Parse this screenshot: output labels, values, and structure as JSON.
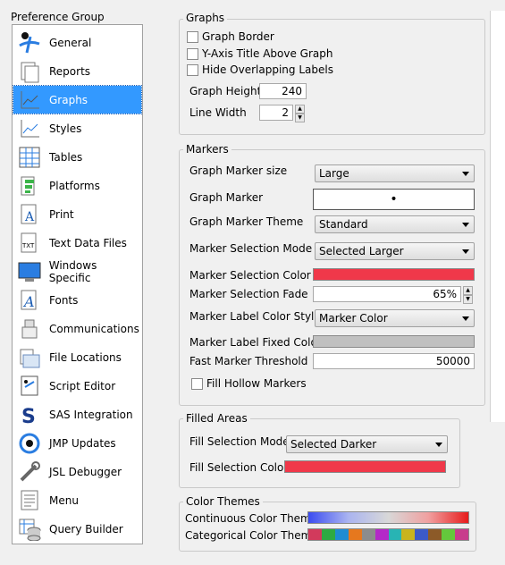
{
  "preference_group": {
    "title": "Preference Group",
    "items": [
      {
        "label": "General",
        "icon": "general-icon"
      },
      {
        "label": "Reports",
        "icon": "reports-icon"
      },
      {
        "label": "Graphs",
        "icon": "graphs-icon",
        "selected": true
      },
      {
        "label": "Styles",
        "icon": "styles-icon"
      },
      {
        "label": "Tables",
        "icon": "tables-icon"
      },
      {
        "label": "Platforms",
        "icon": "platforms-icon"
      },
      {
        "label": "Print",
        "icon": "print-icon"
      },
      {
        "label": "Text Data Files",
        "icon": "text-data-files-icon"
      },
      {
        "label": "Windows Specific",
        "icon": "windows-specific-icon"
      },
      {
        "label": "Fonts",
        "icon": "fonts-icon"
      },
      {
        "label": "Communications",
        "icon": "communications-icon"
      },
      {
        "label": "File Locations",
        "icon": "file-locations-icon"
      },
      {
        "label": "Script Editor",
        "icon": "script-editor-icon"
      },
      {
        "label": "SAS Integration",
        "icon": "sas-integration-icon"
      },
      {
        "label": "JMP Updates",
        "icon": "jmp-updates-icon"
      },
      {
        "label": "JSL Debugger",
        "icon": "jsl-debugger-icon"
      },
      {
        "label": "Menu",
        "icon": "menu-icon"
      },
      {
        "label": "Query Builder",
        "icon": "query-builder-icon"
      }
    ]
  },
  "graphs": {
    "title": "Graphs",
    "graph_border": "Graph Border",
    "y_axis_title": "Y-Axis Title Above Graph",
    "hide_overlapping": "Hide Overlapping Labels",
    "graph_height_label": "Graph Height",
    "graph_height_value": "240",
    "line_width_label": "Line Width",
    "line_width_value": "2"
  },
  "markers": {
    "title": "Markers",
    "marker_size_label": "Graph Marker size",
    "marker_size_value": "Large",
    "graph_marker_label": "Graph Marker",
    "graph_marker_value": "•",
    "theme_label": "Graph Marker Theme",
    "theme_value": "Standard",
    "selection_mode_label": "Marker Selection Mode",
    "selection_mode_value": "Selected Larger",
    "selection_color_label": "Marker Selection Color",
    "selection_color": "#f0384a",
    "selection_fade_label": "Marker Selection Fade",
    "selection_fade_value": "65%",
    "label_color_style_label": "Marker Label Color Style",
    "label_color_style_value": "Marker Color",
    "label_fixed_color_label": "Marker Label Fixed Color",
    "label_fixed_color": "#c0c0c0",
    "fast_threshold_label": "Fast Marker Threshold",
    "fast_threshold_value": "50000",
    "fill_hollow_label": "Fill Hollow Markers"
  },
  "filled_areas": {
    "title": "Filled Areas",
    "fill_mode_label": "Fill Selection Mode",
    "fill_mode_value": "Selected Darker",
    "fill_color_label": "Fill Selection Color",
    "fill_color": "#f0384a"
  },
  "color_themes": {
    "title": "Color Themes",
    "continuous_label": "Continuous Color Theme",
    "categorical_label": "Categorical Color Theme",
    "continuous_gradient": [
      "#3b4cf0",
      "#aab4f0",
      "#d8d8d8",
      "#f0a0a0",
      "#e81c1c"
    ],
    "categorical_colors": [
      "#d23a5c",
      "#2eaa42",
      "#1e8cd2",
      "#e6781e",
      "#8c8c8c",
      "#b428c8",
      "#28b4b4",
      "#c8b41e",
      "#3c5ac8",
      "#8c5a28",
      "#64c83c",
      "#c83c8c"
    ]
  }
}
